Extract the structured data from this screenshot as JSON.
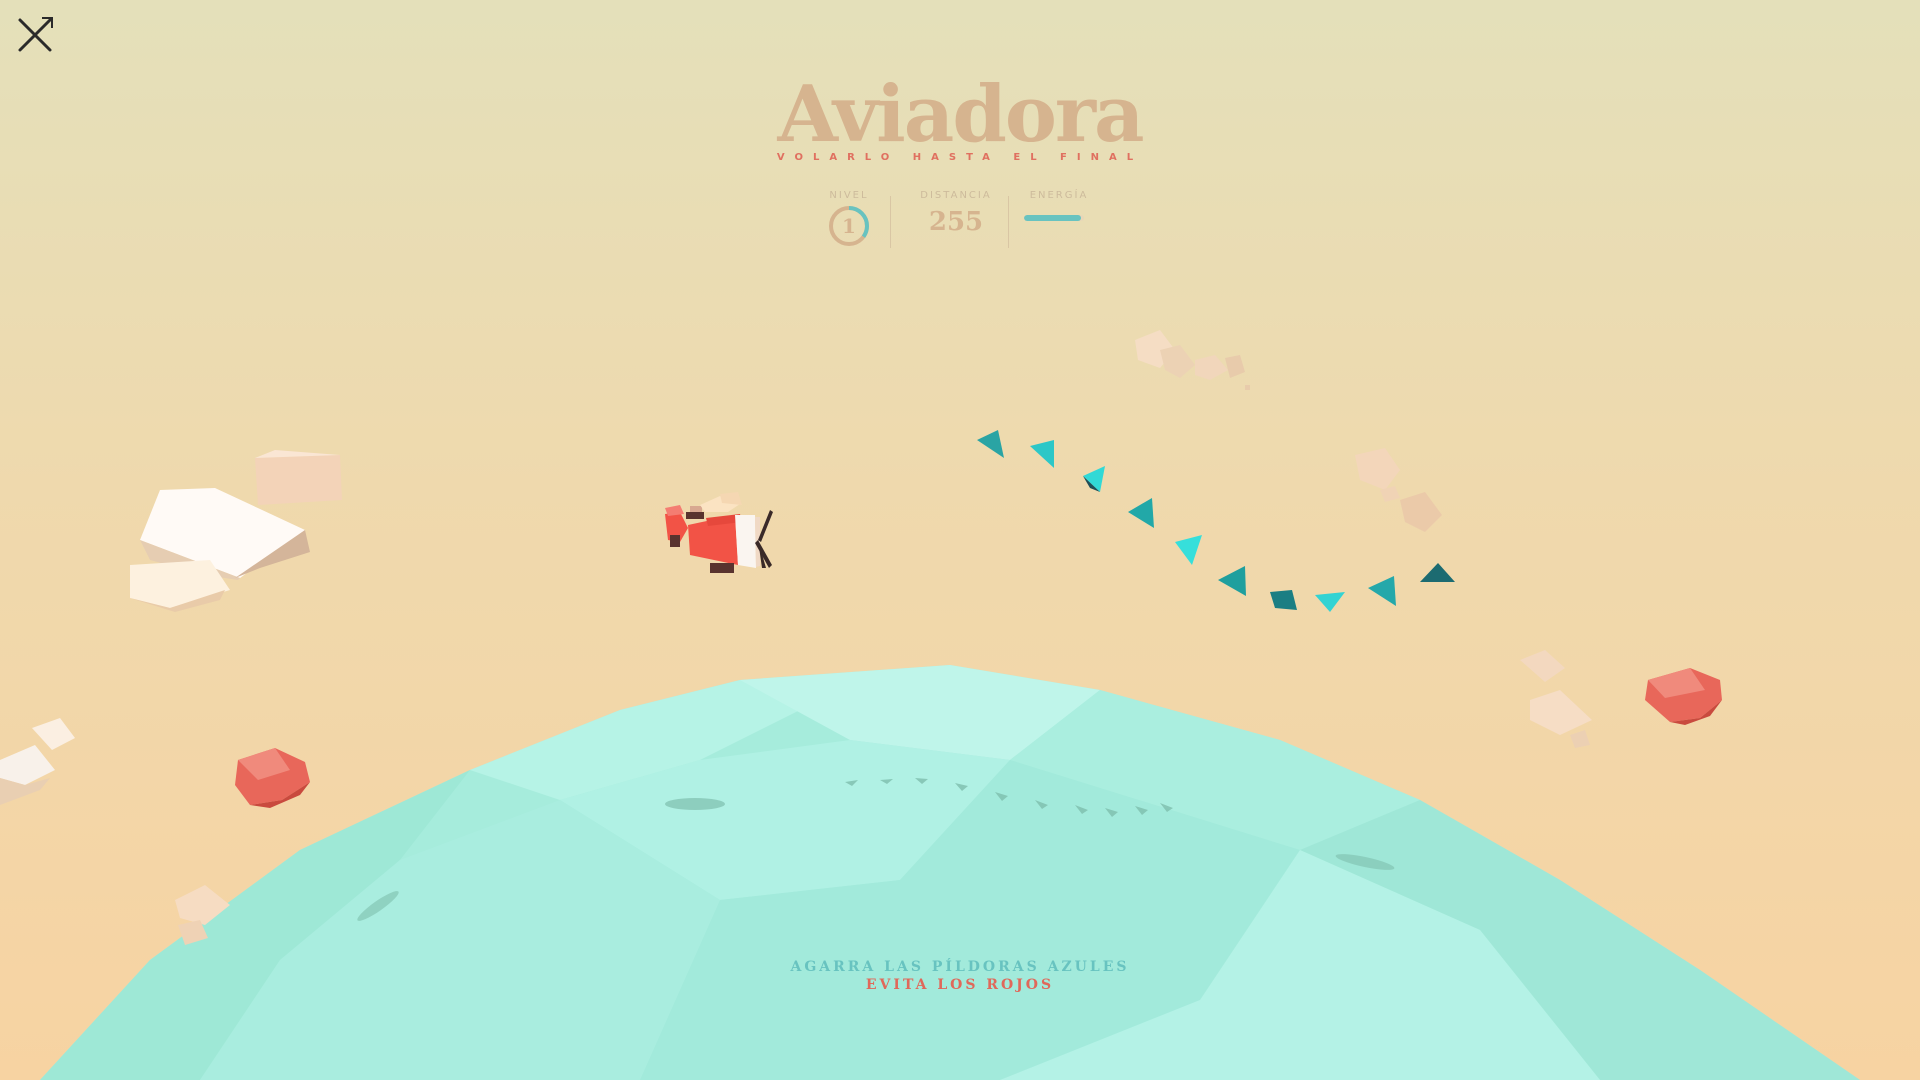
{
  "game": {
    "title": "Aviadora",
    "subtitle": "VOLARLO HASTA EL FINAL"
  },
  "hud": {
    "level_label": "NIVEL",
    "level_value": "1",
    "level_progress": 0.35,
    "distance_label": "DISTANCIA",
    "distance_value": "255",
    "energy_label": "ENERGÍA",
    "energy_fraction": 0.95
  },
  "instructions": {
    "line1": "AGARRA LAS PÍLDORAS AZULES",
    "line2": "EVITA LOS ROJOS"
  },
  "colors": {
    "sky_top": "#e4e0ba",
    "sky_bottom": "#f7d3a2",
    "sea": "#a8efe0",
    "title": "#d6b48f",
    "accent_red": "#e0685a",
    "accent_teal": "#68c3c0",
    "plane_red": "#f25346"
  },
  "icons": {
    "close": "close-icon"
  }
}
